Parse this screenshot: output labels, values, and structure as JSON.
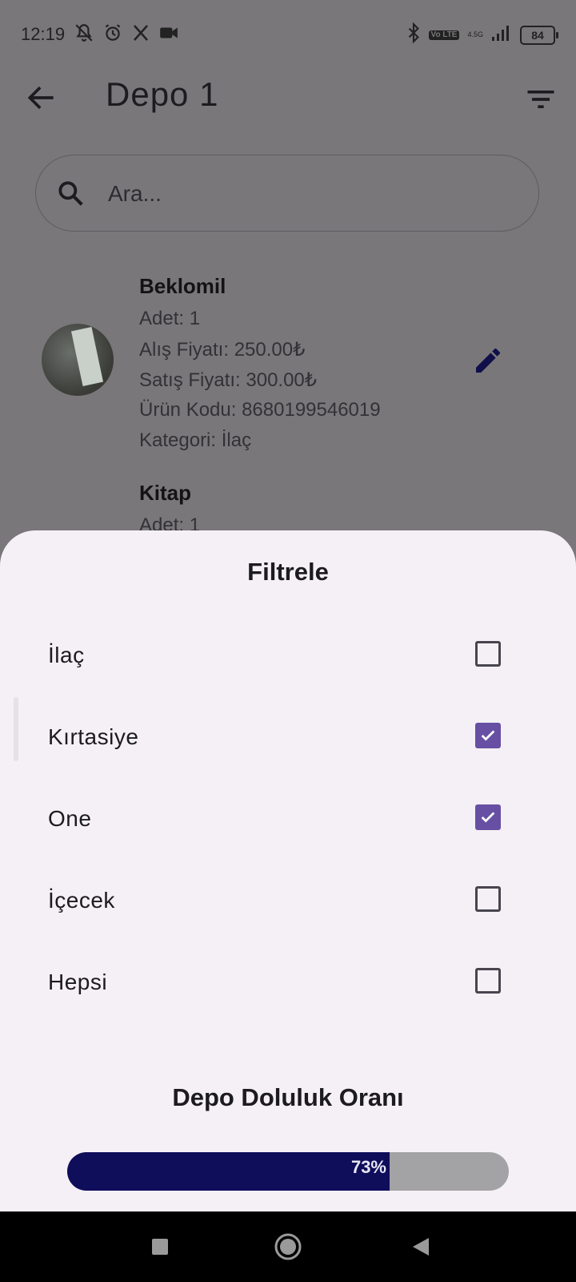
{
  "status_bar": {
    "time": "12:19",
    "network_label": "4.5G",
    "volte_label": "Vo LTE",
    "battery": "84"
  },
  "app_bar": {
    "title": "Depo  1"
  },
  "search": {
    "placeholder": "Ara..."
  },
  "products": [
    {
      "name": "Beklomil",
      "quantity": "Adet: 1",
      "buy_price": "Alış Fiyatı: 250.00₺",
      "sell_price": "Satış Fiyatı: 300.00₺",
      "code": "Ürün Kodu: 8680199546019",
      "category": "Kategori: İlaç"
    },
    {
      "name": "Kitap",
      "quantity": "Adet: 1"
    }
  ],
  "filter_sheet": {
    "title": "Filtrele",
    "options": [
      {
        "label": "İlaç",
        "checked": false
      },
      {
        "label": "Kırtasiye",
        "checked": true
      },
      {
        "label": "One",
        "checked": true
      },
      {
        "label": "İçecek",
        "checked": false
      },
      {
        "label": "Hepsi",
        "checked": false
      }
    ],
    "fill_title": "Depo Doluluk Oranı",
    "fill_percent": 73,
    "fill_label": "73%"
  },
  "colors": {
    "checkbox_checked": "#6750a4",
    "progress_fill": "#0f0e5b",
    "progress_track": "#a3a2a4",
    "scrim": "#797779",
    "sheet": "#f5f0f6"
  }
}
